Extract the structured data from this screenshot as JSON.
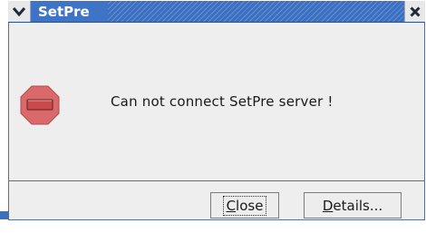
{
  "window": {
    "title": "SetPre",
    "accent_color": "#3a6fc2",
    "menu_icon": "chevron-down-icon",
    "close_icon": "close-icon"
  },
  "dialog": {
    "icon": "stop-error-icon",
    "message": "Can not connect SetPre server !"
  },
  "buttons": {
    "close": {
      "mnemonic": "C",
      "rest": "lose"
    },
    "details": {
      "mnemonic": "D",
      "rest": "etails..."
    }
  }
}
